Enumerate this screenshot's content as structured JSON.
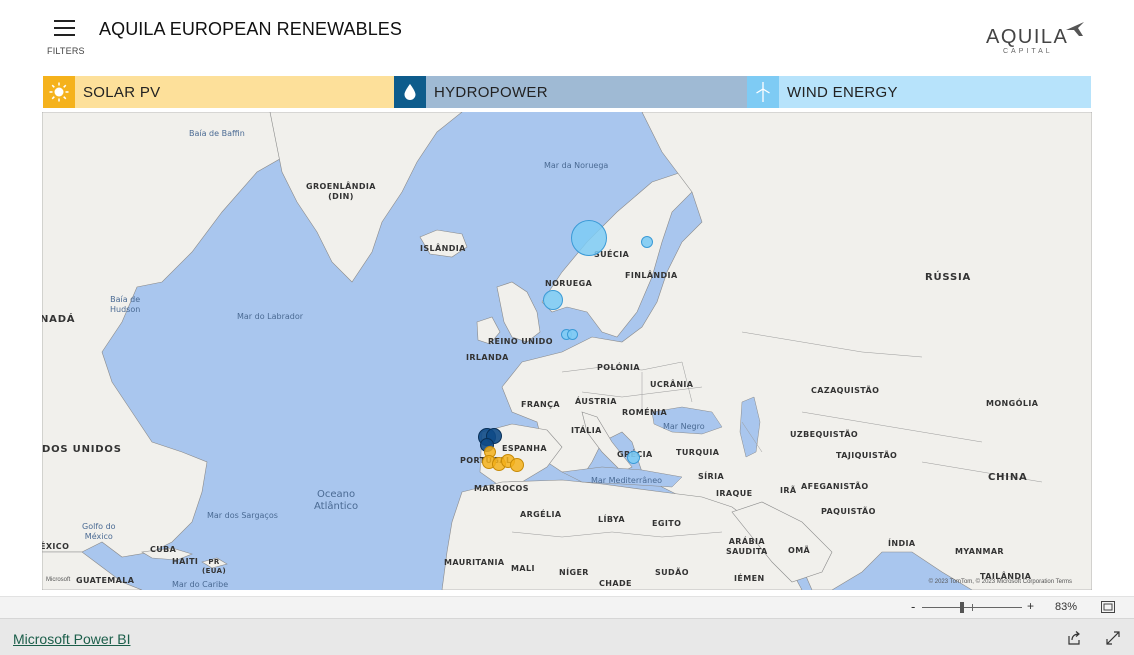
{
  "report": {
    "title": "AQUILA EUROPEAN RENEWABLES",
    "filters_label": "FILTERS"
  },
  "logo": {
    "name": "AQUILA",
    "subtitle": "CAPITAL"
  },
  "tabs": [
    {
      "label": "SOLAR PV",
      "icon": "sun-icon",
      "color": "#f5b21c"
    },
    {
      "label": "HYDROPOWER",
      "icon": "water-drop-icon",
      "color": "#0e5c8c"
    },
    {
      "label": "WIND ENERGY",
      "icon": "wind-turbine-icon",
      "color": "#7ecbf4"
    }
  ],
  "map": {
    "countries": {
      "greenland": "GROENLÂNDIA\n(DIN)",
      "iceland": "ISLÂNDIA",
      "norway": "NORUEGA",
      "sweden": "SUÉCIA",
      "finland": "FINLÂNDIA",
      "russia": "RÚSSIA",
      "uk": "REINO UNIDO",
      "ireland": "IRLANDA",
      "poland": "POLÓNIA",
      "ukraine": "UCRÂNIA",
      "france": "FRANÇA",
      "austria": "ÁUSTRIA",
      "romania": "ROMÉNIA",
      "italy": "ITÁLIA",
      "spain": "ESPANHA",
      "portugal": "PORTUGAL",
      "greece": "GRÉCIA",
      "turkey": "TURQUIA",
      "kazakhstan": "CAZAQUISTÃO",
      "mongolia": "MONGÓLIA",
      "uzbekistan": "UZBEQUISTÃO",
      "tajikistan": "TAJIQUISTÃO",
      "syria": "SÍRIA",
      "iraq": "IRAQUE",
      "iran": "IRÃ",
      "afghanistan": "AFEGANISTÃO",
      "pakistan": "PAQUISTÃO",
      "china": "CHINA",
      "morocco": "MARROCOS",
      "algeria": "ARGÉLIA",
      "libya": "LÍBYA",
      "egypt": "EGITO",
      "saudi": "ARÁBIA\nSAUDITA",
      "oman": "OMÃ",
      "india": "ÍNDIA",
      "myanmar": "MYANMAR",
      "mauritania": "MAURITANIA",
      "mali": "MALI",
      "niger": "NÍGER",
      "chad": "CHADE",
      "sudan": "SUDÃO",
      "yemen": "IÉMEN",
      "thailand": "TAILÂNDIA",
      "canada": "NADÁ",
      "usa": "DOS UNIDOS",
      "mexico": "ÉXICO",
      "cuba": "CUBA",
      "haiti": "HAITI",
      "pr": "PR\n(EUA)",
      "guatemala": "GUATEMALA"
    },
    "seas": {
      "baffin": "Baía de Baffin",
      "norway_sea": "Mar da Noruega",
      "hudson": "Baía de\nHudson",
      "labrador": "Mar do Labrador",
      "black_sea": "Mar Negro",
      "med": "Mar Mediterrâneo",
      "sargasso": "Mar dos Sargaços",
      "caribbean": "Mar do Caribe",
      "gulf_mexico": "Golfo do\nMéxico",
      "atlantic": "Oceano\nAtlântico"
    },
    "attribution": "© 2023 TomTom, © 2023 Microsoft Corporation  Terms",
    "ms_logo": "Microsoft"
  },
  "zoom": {
    "minus": "-",
    "plus": "+",
    "level": "83%"
  },
  "footer": {
    "brand": "Microsoft Power BI"
  },
  "colors": {
    "solar": "#f5b21c",
    "hydro": "#0e4a87",
    "wind": "#7ecbf4"
  }
}
